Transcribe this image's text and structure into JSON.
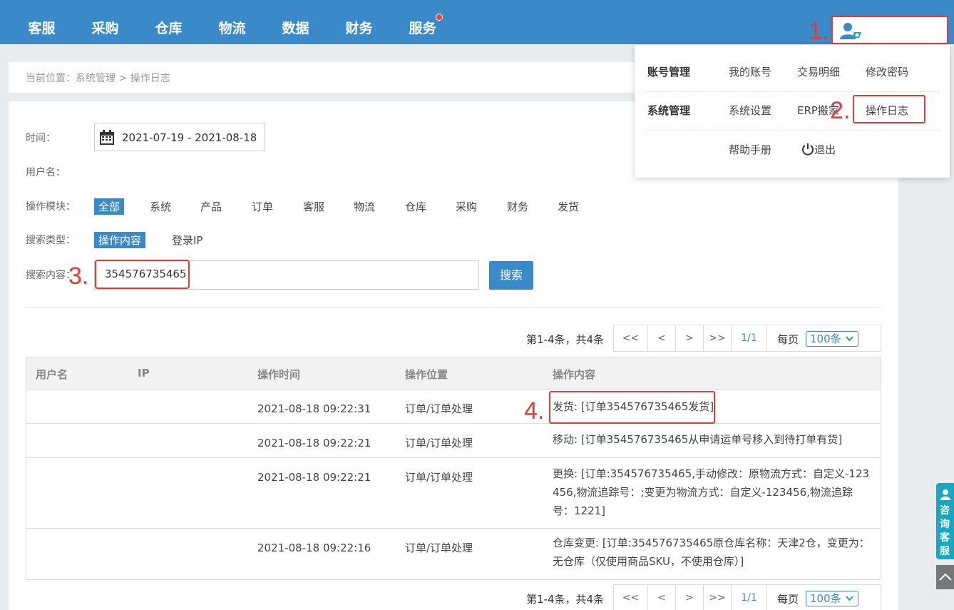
{
  "topnav": [
    "客服",
    "采购",
    "仓库",
    "物流",
    "数据",
    "财务",
    "服务"
  ],
  "annotations": [
    "1.",
    "2.",
    "3.",
    "4."
  ],
  "breadcrumb": "当前位置：系统管理 > 操作日志",
  "filters": {
    "time_label": "时间：",
    "date_range": "2021-07-19 - 2021-08-18",
    "user_label": "用户名：",
    "module_label": "操作模块：",
    "modules": [
      "全部",
      "系统",
      "产品",
      "订单",
      "客服",
      "物流",
      "仓库",
      "采购",
      "财务",
      "发货"
    ],
    "type_label": "搜索类型：",
    "types": [
      "操作内容",
      "登录IP"
    ],
    "content_label": "搜索内容：",
    "content_value": "354576735465",
    "search_button": "搜索"
  },
  "pager": {
    "info": "第1-4条，共4条",
    "first": "<<",
    "prev": "<",
    "next": ">",
    "last": ">>",
    "current": "1/1",
    "per_page_label": "每页",
    "per_page_value": "100条"
  },
  "table": {
    "headers": [
      "用户名",
      "IP",
      "操作时间",
      "操作位置",
      "操作内容"
    ],
    "rows": [
      {
        "user": "",
        "ip": "",
        "time": "2021-08-18 09:22:31",
        "location": "订单/订单处理",
        "content": "发货: [订单354576735465发货]"
      },
      {
        "user": "",
        "ip": "",
        "time": "2021-08-18 09:22:21",
        "location": "订单/订单处理",
        "content": "移动: [订单354576735465从申请运单号移入到待打单有货]"
      },
      {
        "user": "",
        "ip": "",
        "time": "2021-08-18 09:22:21",
        "location": "订单/订单处理",
        "content": "更换: [订单:354576735465,手动修改：原物流方式：自定义-123456,物流追踪号：;变更为物流方式：自定义-123456,物流追踪号：1221]"
      },
      {
        "user": "",
        "ip": "",
        "time": "2021-08-18 09:22:16",
        "location": "订单/订单处理",
        "content": "仓库变更: [订单:354576735465原仓库名称：天津2仓，变更为：无仓库（仅使用商品SKU，不使用仓库）]"
      }
    ]
  },
  "dropdown": {
    "account_head": "账号管理",
    "my_account": "我的账号",
    "transactions": "交易明细",
    "change_password": "修改密码",
    "system_head": "系统管理",
    "system_settings": "系统设置",
    "erp_move": "ERP搬家",
    "operation_log": "操作日志",
    "help": "帮助手册",
    "logout": "退出"
  },
  "side": {
    "consult": "咨询客服"
  },
  "colors": {
    "primary": "#3a89c9",
    "annotation": "#e53935",
    "side": "#16a7c4"
  }
}
